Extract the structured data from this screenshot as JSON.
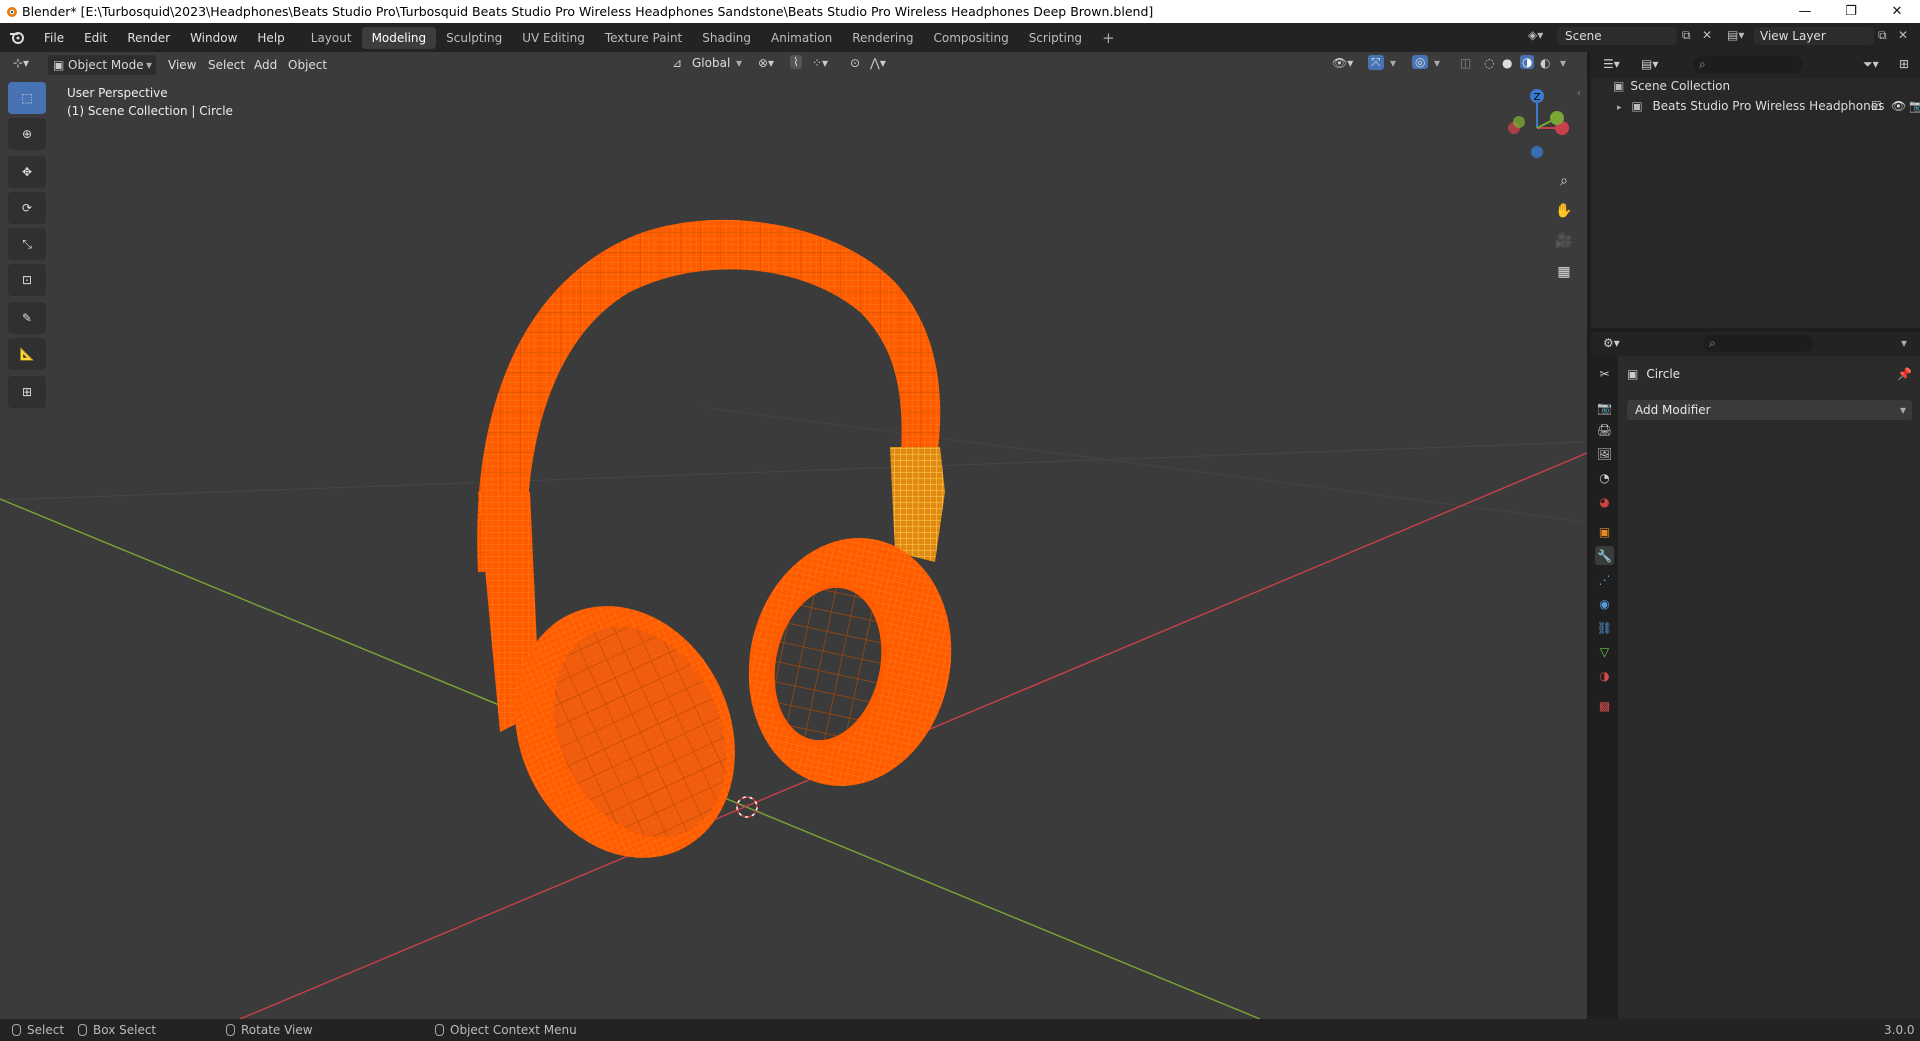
{
  "window": {
    "title": "Blender* [E:\\Turbosquid\\2023\\Headphones\\Beats Studio Pro\\Turbosquid Beats Studio Pro Wireless Headphones Sandstone\\Beats Studio Pro Wireless Headphones Deep Brown.blend]",
    "minimize": "—",
    "maximize": "❐",
    "close": "✕"
  },
  "menu": [
    "File",
    "Edit",
    "Render",
    "Window",
    "Help"
  ],
  "workspaces": [
    "Layout",
    "Modeling",
    "Sculpting",
    "UV Editing",
    "Texture Paint",
    "Shading",
    "Animation",
    "Rendering",
    "Compositing",
    "Scripting"
  ],
  "active_workspace": "Modeling",
  "workspace_add": "+",
  "scene": "Scene",
  "view_layer": "View Layer",
  "viewport": {
    "mode": "Object Mode",
    "menus": [
      "View",
      "Select",
      "Add",
      "Object"
    ],
    "orientation": "Global",
    "perspective": "User Perspective",
    "collection_info": "(1) Scene Collection | Circle",
    "gizmo_labels": {
      "z": "Z"
    }
  },
  "outliner": {
    "root": "Scene Collection",
    "items": [
      {
        "label": "Beats Studio Pro Wireless Headphones"
      }
    ]
  },
  "properties": {
    "object_name": "Circle",
    "add_modifier": "Add Modifier"
  },
  "status": {
    "select": "Select",
    "box_select": "Box Select",
    "rotate": "Rotate View",
    "context": "Object Context Menu",
    "version": "3.0.0"
  },
  "colors": {
    "accent": "#4772b3",
    "selection": "#ff6a00",
    "active_object": "#ffaa40",
    "x_axis": "#c8404a",
    "y_axis": "#7aa636",
    "z_axis": "#3a7ad0"
  }
}
